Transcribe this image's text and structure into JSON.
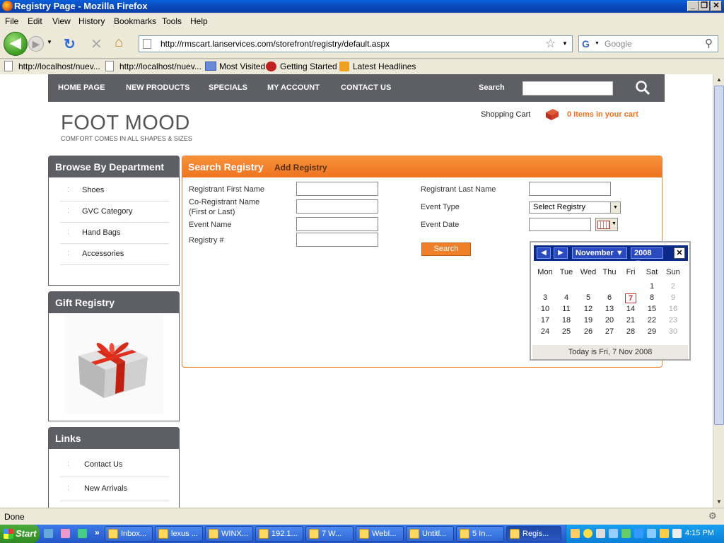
{
  "window": {
    "title": "Registry Page - Mozilla Firefox",
    "min": "_",
    "max": "❐",
    "close": "✕"
  },
  "menu": [
    "File",
    "Edit",
    "View",
    "History",
    "Bookmarks",
    "Tools",
    "Help"
  ],
  "nav": {
    "back": "◀",
    "forward": "▶",
    "url": "http://rmscart.lanservices.com/storefront/registry/default.aspx",
    "search_placeholder": "Google",
    "google_glyph": "G"
  },
  "bookmarks": [
    "http://localhost/nuev...",
    "http://localhost/nuev...",
    "Most Visited",
    "Getting Started",
    "Latest Headlines"
  ],
  "site": {
    "nav": [
      "HOME PAGE",
      "NEW PRODUCTS",
      "SPECIALS",
      "MY ACCOUNT",
      "CONTACT US"
    ],
    "search_label": "Search",
    "logo": "FOOT MOOD",
    "tagline": "COMFORT COMES IN ALL SHAPES & SIZES",
    "cart_label": "Shopping Cart",
    "cart_count": "0 Items in your cart",
    "departments": {
      "title": "Browse By Department",
      "items": [
        "Shoes",
        "GVC Category",
        "Hand Bags",
        "Accessories"
      ]
    },
    "gift": {
      "title": "Gift Registry"
    },
    "links": {
      "title": "Links",
      "items": [
        "Contact Us",
        "New Arrivals"
      ]
    },
    "registry": {
      "tab_search": "Search Registry",
      "tab_add": "Add Registry",
      "first_name": "Registrant First Name",
      "last_name": "Registrant Last Name",
      "co_name_1": "Co-Registrant Name",
      "co_name_2": "(First or Last)",
      "event_type": "Event Type",
      "event_type_value": "Select Registry",
      "event_name": "Event Name",
      "event_date": "Event Date",
      "registry_no": "Registry #",
      "search_button": "Search"
    },
    "calendar": {
      "month": "November ▼",
      "year": "2008 ▼",
      "prev": "◀",
      "next": "▶",
      "close": "✕",
      "weekdays": [
        "Mon",
        "Tue",
        "Wed",
        "Thu",
        "Fri",
        "Sat",
        "Sun"
      ],
      "weeks": [
        [
          "",
          "",
          "",
          "",
          "",
          "1",
          "2"
        ],
        [
          "3",
          "4",
          "5",
          "6",
          "7",
          "8",
          "9"
        ],
        [
          "10",
          "11",
          "12",
          "13",
          "14",
          "15",
          "16"
        ],
        [
          "17",
          "18",
          "19",
          "20",
          "21",
          "22",
          "23"
        ],
        [
          "24",
          "25",
          "26",
          "27",
          "28",
          "29",
          "30"
        ]
      ],
      "today_day": "7",
      "footer_prefix": "Today is ",
      "footer_date": "Fri, 7 Nov 2008"
    }
  },
  "status": "Done",
  "taskbar": {
    "start": "Start",
    "tasks": [
      "Inbox...",
      "lexus ...",
      "WINX...",
      "192.1...",
      "7 W...",
      "WebI...",
      "Untitl...",
      "5 In...",
      "Regis..."
    ],
    "clock": "4:15 PM"
  }
}
